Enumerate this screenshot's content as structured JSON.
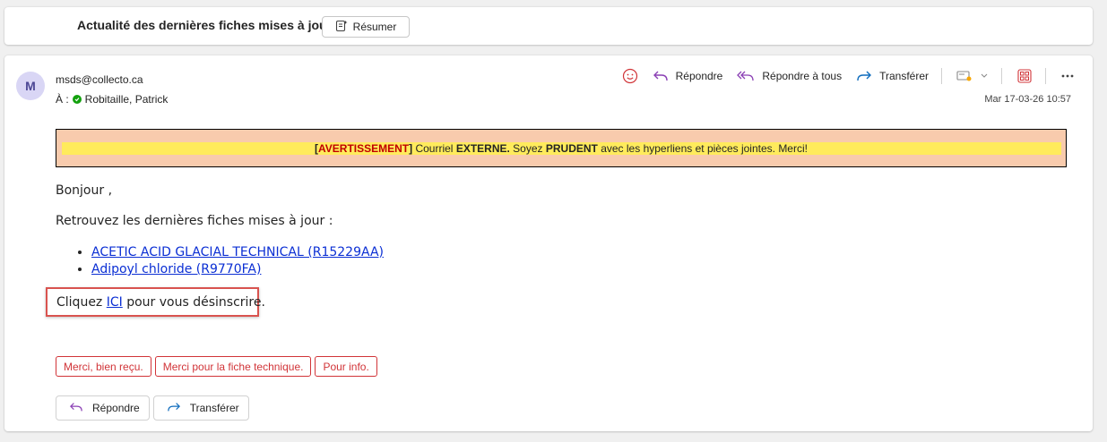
{
  "header": {
    "subject": "Actualité des dernières fiches mises à jour",
    "summarize_label": "Résumer"
  },
  "message": {
    "avatar_initial": "M",
    "sender": "msds@collecto.ca",
    "to_label": "À :",
    "recipient": "Robitaille, Patrick",
    "timestamp": "Mar 17-03-26 10:57"
  },
  "actions": {
    "reply": "Répondre",
    "reply_all": "Répondre à tous",
    "forward": "Transférer"
  },
  "warning": {
    "bracket_open": "[",
    "tag": "AVERTISSEMENT",
    "bracket_close": "]",
    "text1": " Courriel ",
    "externe": "EXTERNE.",
    "text2": " Soyez ",
    "prudent": "PRUDENT",
    "text3": " avec les hyperliens et pièces jointes. Merci!"
  },
  "body": {
    "greeting": "Bonjour ,",
    "intro": "Retrouvez les dernières fiches mises à jour :",
    "sheets": [
      "ACETIC ACID GLACIAL TECHNICAL (R15229AA)",
      "Adipoyl chloride (R9770FA)"
    ],
    "unsub_prefix": "Cliquez ",
    "unsub_link": "ICI",
    "unsub_suffix": " pour vous désinscrire."
  },
  "quick_replies": [
    "Merci, bien reçu.",
    "Merci pour la fiche technique.",
    "Pour info."
  ],
  "bottom": {
    "reply": "Répondre",
    "forward": "Transférer"
  },
  "colors": {
    "accent_purple": "#8a3fb4",
    "forward_blue": "#0f6cbd",
    "quick_reply_red": "#d13438",
    "warning_bg": "#f8cbad",
    "warning_band": "#ffeb5c",
    "presence_green": "#13a10e"
  }
}
